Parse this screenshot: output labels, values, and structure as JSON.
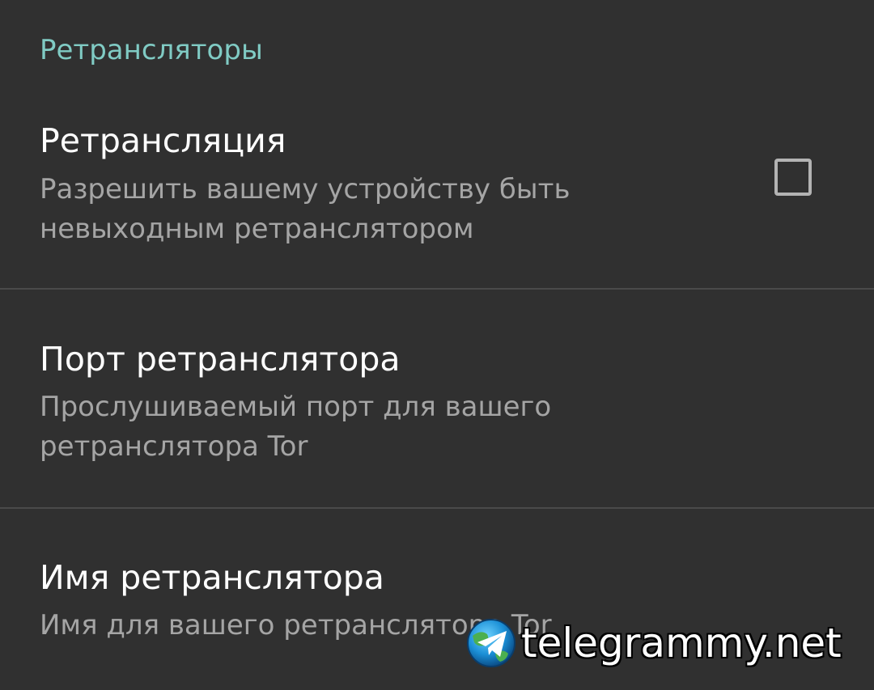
{
  "section": {
    "title": "Ретрансляторы"
  },
  "preferences": [
    {
      "title": "Ретрансляция",
      "summary": "Разрешить вашему устройству быть невыходным ретранслятором",
      "checked": false
    },
    {
      "title": "Порт ретранслятора",
      "summary": "Прослушиваемый порт для вашего ретранслятора Tor"
    },
    {
      "title": "Имя ретранслятора",
      "summary": "Имя для вашего ретранслятора Tor"
    }
  ],
  "watermark": {
    "text": "telegrammy.net"
  },
  "colors": {
    "background": "#303030",
    "accent": "#80cbc4",
    "title": "#ffffff",
    "summary": "#a5a5a5",
    "divider": "#4a4a4a"
  }
}
